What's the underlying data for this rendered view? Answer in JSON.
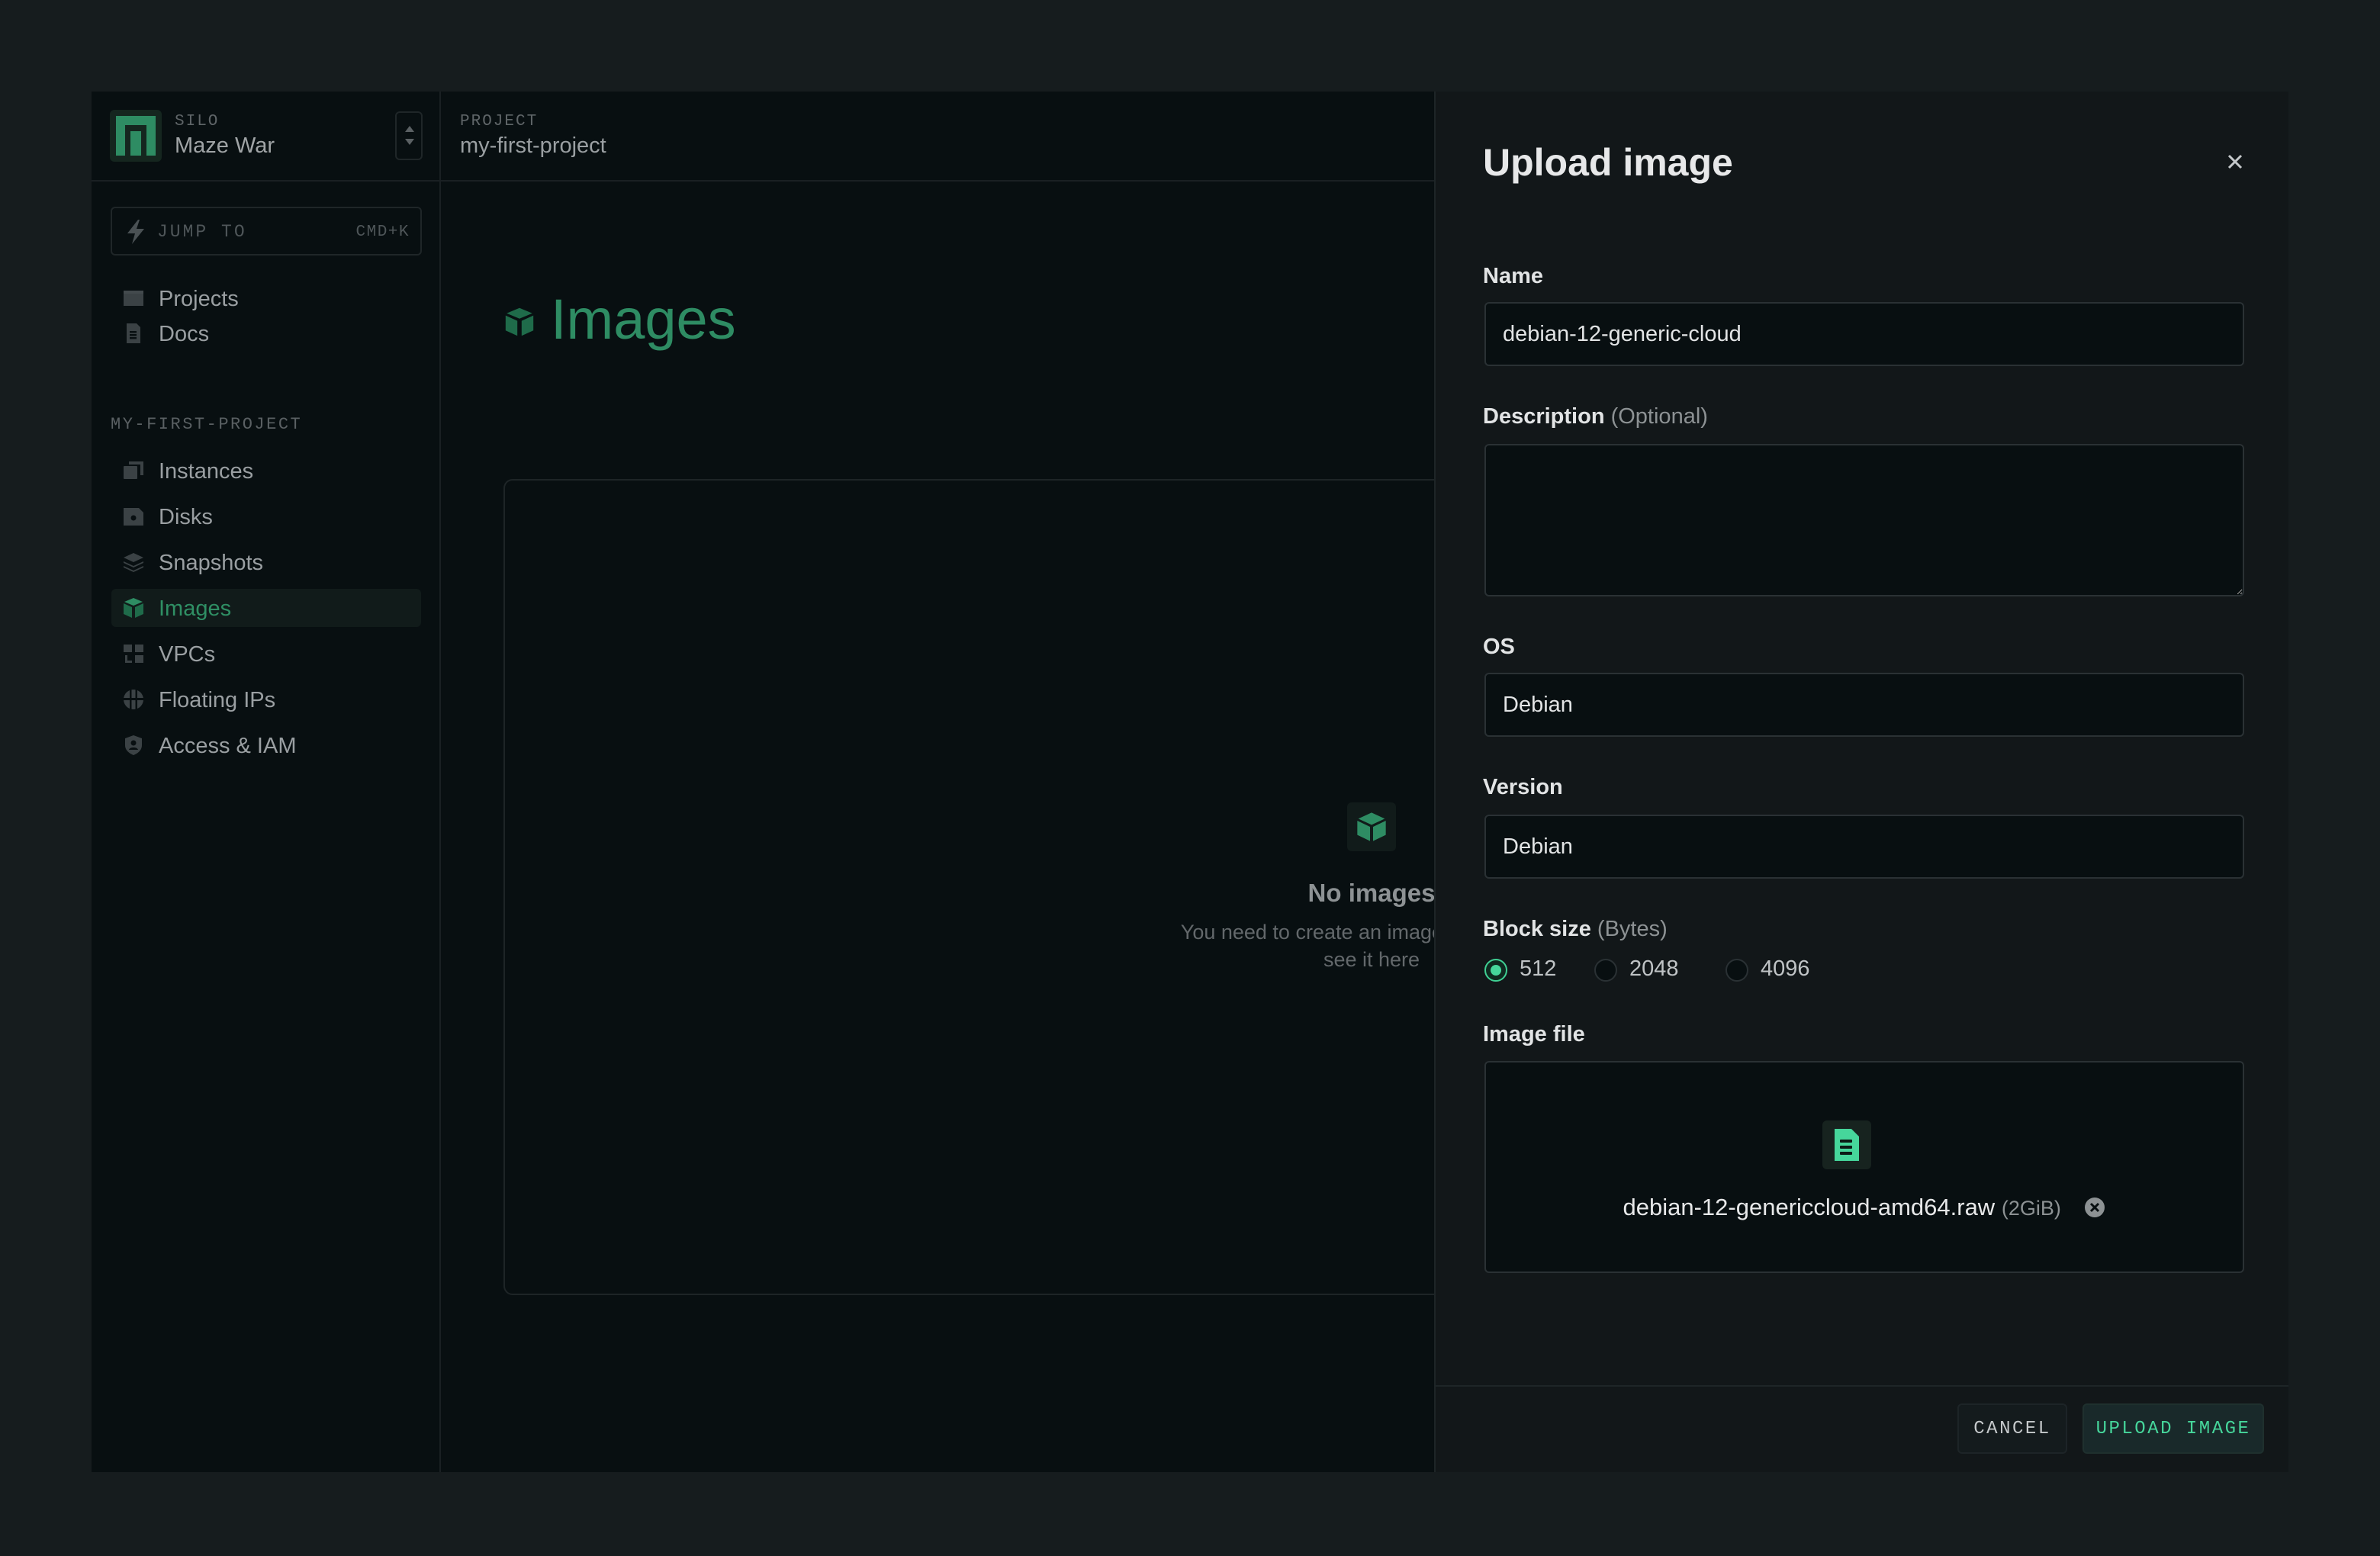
{
  "colors": {
    "accent": "#2e8c63",
    "accent_bright": "#46d69b",
    "background": "#080f11",
    "panel": "#121719",
    "outer": "#161c1e"
  },
  "silo": {
    "kicker": "SILO",
    "name": "Maze War",
    "logo_icon": "oxide-logo-icon",
    "switcher_icon": "select-arrows-icon"
  },
  "jump_to": {
    "label": "JUMP TO",
    "shortcut": "CMD+K",
    "icon": "lightning-icon"
  },
  "sidebar": {
    "global_items": [
      {
        "label": "Projects",
        "icon": "folder-icon"
      },
      {
        "label": "Docs",
        "icon": "document-icon"
      }
    ],
    "section_label": "MY-FIRST-PROJECT",
    "project_items": [
      {
        "label": "Instances",
        "icon": "instances-icon",
        "active": false
      },
      {
        "label": "Disks",
        "icon": "disk-icon",
        "active": false
      },
      {
        "label": "Snapshots",
        "icon": "layers-icon",
        "active": false
      },
      {
        "label": "Images",
        "icon": "cube-icon",
        "active": true
      },
      {
        "label": "VPCs",
        "icon": "networking-icon",
        "active": false
      },
      {
        "label": "Floating IPs",
        "icon": "globe-icon",
        "active": false
      },
      {
        "label": "Access & IAM",
        "icon": "shield-icon",
        "active": false
      }
    ]
  },
  "topbar": {
    "kicker": "PROJECT",
    "project_name": "my-first-project"
  },
  "page": {
    "title": "Images",
    "empty_state": {
      "title": "No images",
      "description": "You need to create an image to be able to see it here"
    }
  },
  "upload_panel": {
    "title": "Upload image",
    "close_label": "Close",
    "fields": {
      "name": {
        "label": "Name",
        "value": "debian-12-generic-cloud"
      },
      "description": {
        "label": "Description",
        "hint": "(Optional)",
        "value": ""
      },
      "os": {
        "label": "OS",
        "value": "Debian"
      },
      "version": {
        "label": "Version",
        "value": "Debian"
      },
      "block_size": {
        "label": "Block size",
        "hint": "(Bytes)",
        "options": [
          "512",
          "2048",
          "4096"
        ],
        "selected": "512"
      },
      "image_file": {
        "label": "Image file",
        "file_name": "debian-12-genericcloud-amd64.raw",
        "file_size": "(2GiB)"
      }
    },
    "buttons": {
      "cancel": "CANCEL",
      "submit": "UPLOAD IMAGE"
    }
  }
}
